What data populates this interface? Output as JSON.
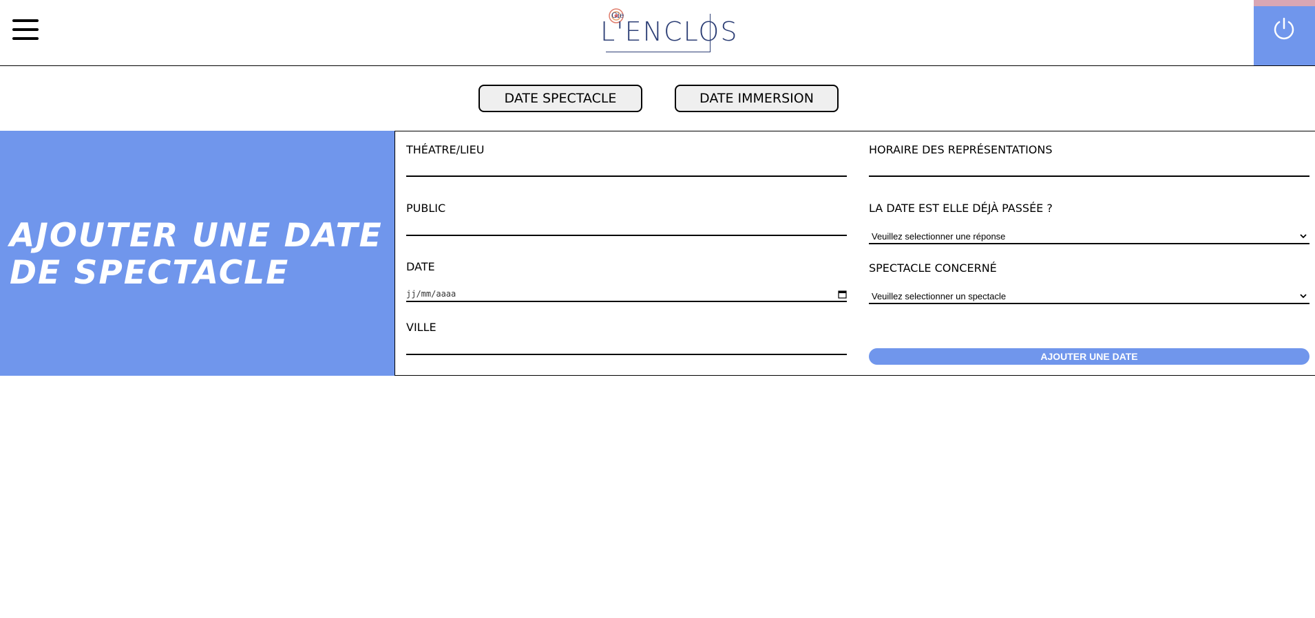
{
  "header": {
    "logo_text": "L'ENCLOS",
    "logo_small": "Cie",
    "accent_color": "#7096ec",
    "power_label_icon": "power-icon",
    "menu_icon": "hamburger-menu-icon"
  },
  "tabs": [
    {
      "label": "DATE SPECTACLE"
    },
    {
      "label": "DATE IMMERSION"
    }
  ],
  "left_panel": {
    "title": "Ajouter une date de spectacle"
  },
  "form": {
    "theatre_label": "THÉATRE/LIEU",
    "theatre_value": "",
    "horaire_label": "HORAIRE DES REPRÉSENTATIONS",
    "horaire_value": "",
    "public_label": "PUBLIC",
    "public_value": "",
    "passee_label": "LA DATE EST ELLE DÉJÀ PASSÉE ?",
    "passee_selected": "Veuillez selectionner une réponse",
    "date_label": "DATE",
    "date_placeholder": "jj/mm/aaaa",
    "spectacle_label": "SPECTACLE CONCERNÉ",
    "spectacle_selected": "Veuillez selectionner un spectacle",
    "ville_label": "VILLE",
    "ville_value": "",
    "submit_label": "AJOUTER UNE DATE"
  }
}
